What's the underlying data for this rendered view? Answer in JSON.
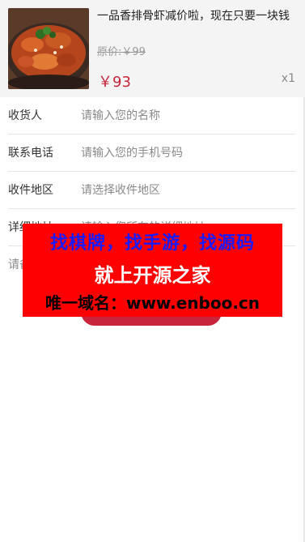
{
  "product": {
    "name": "一品香排骨虾减价啦，现在只要一块钱",
    "original_price": "原价:￥99",
    "price": "￥93",
    "quantity": "x1"
  },
  "form": {
    "fields": [
      {
        "label": "收货人",
        "placeholder": "请输入您的名称"
      },
      {
        "label": "联系电话",
        "placeholder": "请输入您的手机号码"
      },
      {
        "label": "收件地区",
        "placeholder": "请选择收件地区"
      },
      {
        "label": "详细地址",
        "placeholder": "请输入您所在的详细地址"
      },
      {
        "label": "",
        "placeholder": "请备注"
      }
    ]
  },
  "watermark": {
    "line1": "找棋牌，找手游，找源码",
    "line2": "就上开源之家",
    "line3": "唯一域名：www.enboo.cn"
  },
  "colors": {
    "accent": "#c8243b",
    "watermark_bg": "#ff0000",
    "watermark_blue": "#1a1aff"
  }
}
